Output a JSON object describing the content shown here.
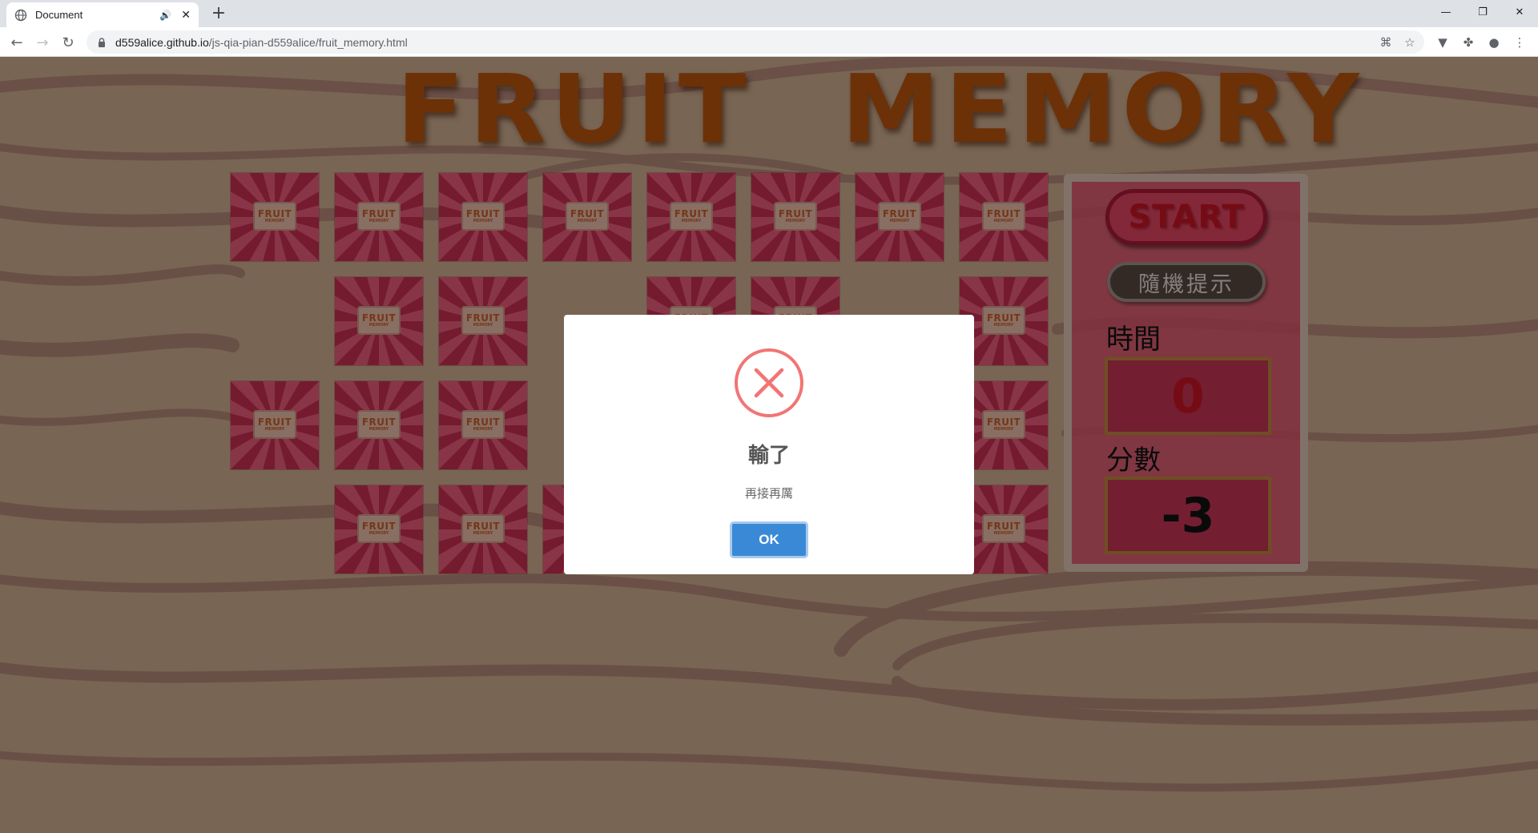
{
  "browser": {
    "tab_title": "Document",
    "url_host": "d559alice.github.io",
    "url_path": "/js-qia-pian-d559alice/fruit_memory.html"
  },
  "game": {
    "title": "FRUIT MEMORY",
    "card_back_line1": "FRUIT",
    "card_back_line2": "MEMORY",
    "start_label": "START",
    "hint_label": "隨機提示",
    "time_label": "時間",
    "time_value": "0",
    "score_label": "分數",
    "score_value": "-3",
    "colors": {
      "title": "#b4530d",
      "card_red": "#c22d4f",
      "card_pink": "#e35a77",
      "time_value": "#c41424",
      "score_value": "#111111"
    }
  },
  "modal": {
    "icon": "error-x-icon",
    "title": "輸了",
    "text": "再接再厲",
    "ok_label": "OK",
    "accent": "#3a89d6"
  },
  "cards": [
    {
      "row": 1,
      "col": 1
    },
    {
      "row": 1,
      "col": 2
    },
    {
      "row": 1,
      "col": 3
    },
    {
      "row": 1,
      "col": 4
    },
    {
      "row": 1,
      "col": 5
    },
    {
      "row": 1,
      "col": 6
    },
    {
      "row": 1,
      "col": 7
    },
    {
      "row": 1,
      "col": 8
    },
    {
      "row": 2,
      "col": 2
    },
    {
      "row": 2,
      "col": 3
    },
    {
      "row": 2,
      "col": 5
    },
    {
      "row": 2,
      "col": 6
    },
    {
      "row": 2,
      "col": 8
    },
    {
      "row": 3,
      "col": 1
    },
    {
      "row": 3,
      "col": 2
    },
    {
      "row": 3,
      "col": 3
    },
    {
      "row": 3,
      "col": 8
    },
    {
      "row": 4,
      "col": 2
    },
    {
      "row": 4,
      "col": 3
    },
    {
      "row": 4,
      "col": 4
    },
    {
      "row": 4,
      "col": 8
    }
  ]
}
